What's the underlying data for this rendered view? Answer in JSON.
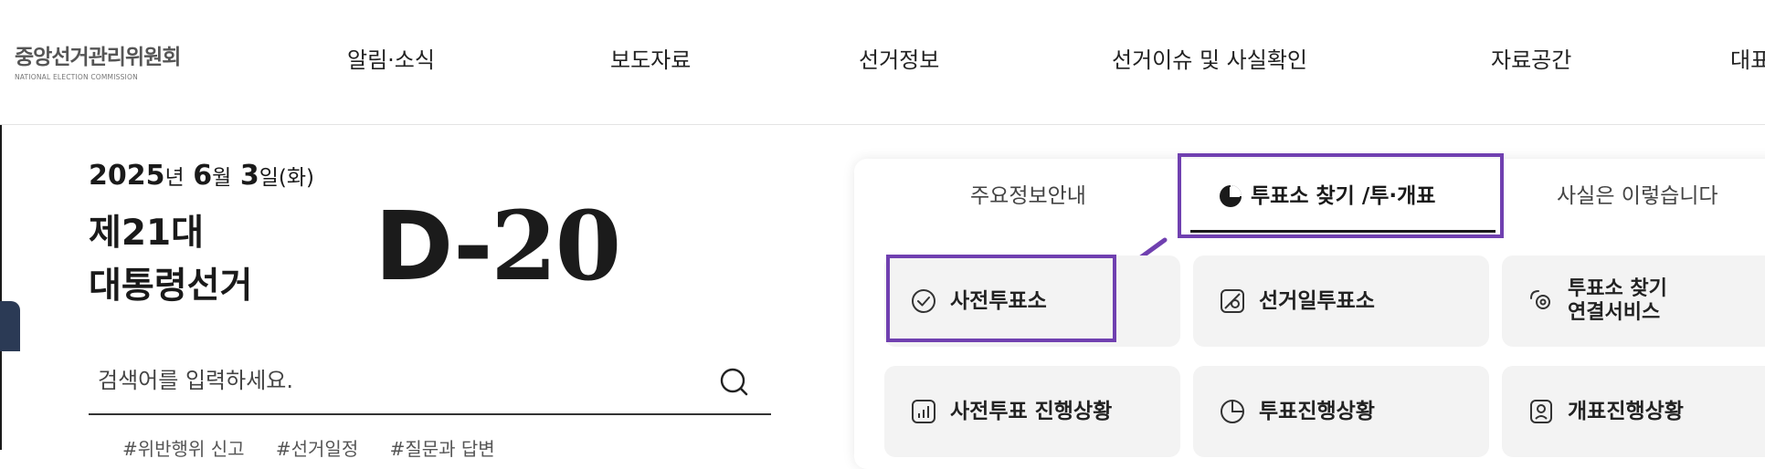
{
  "header": {
    "logo": {
      "korean": "중앙선거관리위원회",
      "english": "NATIONAL ELECTION COMMISSION"
    },
    "nav": [
      "알림·소식",
      "보도자료",
      "선거정보",
      "선거이슈 및 사실확인",
      "자료공간",
      "대표"
    ]
  },
  "election": {
    "date_year": "2025",
    "date_year_unit": "년",
    "date_month": "6",
    "date_month_unit": "월",
    "date_day": "3",
    "date_day_unit": "일",
    "date_weekday": "(화)",
    "title_line1": "제21대",
    "title_line2": "대통령선거",
    "dday_prefix": "D-",
    "dday_number": "20"
  },
  "search": {
    "placeholder": "검색어를 입력하세요.",
    "tags": [
      "#위반행위 신고",
      "#선거일정",
      "#질문과 답변"
    ]
  },
  "panel": {
    "tabs": [
      "주요정보안내",
      "투표소 찾기 /투·개표",
      "사실은 이렇습니다"
    ],
    "active_tab_index": 1,
    "cards_row1": [
      {
        "label": "사전투표소",
        "icon": "check-circle-icon"
      },
      {
        "label": "선거일투표소",
        "icon": "map-pin-icon"
      },
      {
        "label_line1": "투표소 찾기",
        "label_line2": "연결서비스",
        "icon": "link-icon"
      }
    ],
    "cards_row2": [
      {
        "label": "사전투표 진행상황",
        "icon": "bar-chart-icon"
      },
      {
        "label": "투표진행상황",
        "icon": "pie-chart-icon"
      },
      {
        "label": "개표진행상황",
        "icon": "ballot-icon"
      }
    ]
  },
  "colors": {
    "highlight": "#7040b0",
    "dark_tab": "#2b3a55",
    "card_bg": "#f3f3f3"
  }
}
